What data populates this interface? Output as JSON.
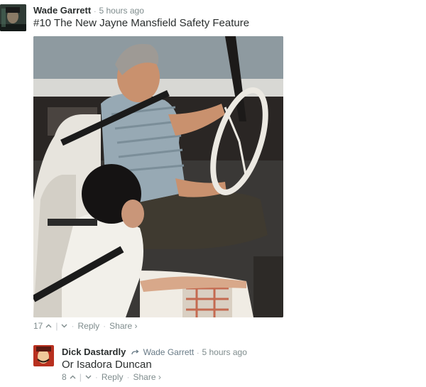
{
  "comments": [
    {
      "author": "Wade Garrett",
      "time": "5 hours ago",
      "text": "#10 The New Jayne Mansfield Safety Feature",
      "votes": "17",
      "reply_label": "Reply",
      "share_label": "Share ›"
    },
    {
      "author": "Dick Dastardly",
      "reply_to": "Wade Garrett",
      "time": "5 hours ago",
      "text": "Or Isadora Duncan",
      "votes": "8",
      "reply_label": "Reply",
      "share_label": "Share ›"
    }
  ],
  "icons": {
    "upvote": "chevron-up",
    "downvote": "chevron-down",
    "reply_arrow": "reply-arrow"
  },
  "colors": {
    "text": "#2a2e2e",
    "muted": "#7f8c8d",
    "link_muted": "#687a86"
  }
}
